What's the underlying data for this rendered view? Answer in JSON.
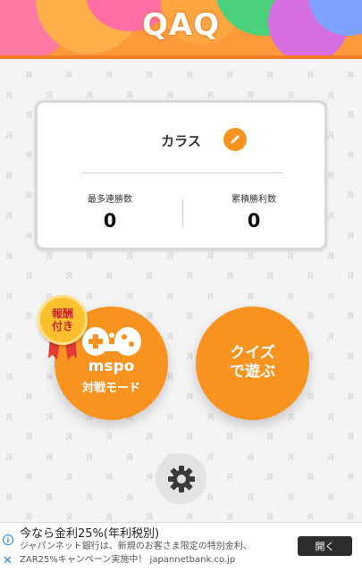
{
  "app": {
    "logo_text": "QAQ"
  },
  "profile": {
    "username": "カラス",
    "edit_icon": "pencil-icon",
    "stats": [
      {
        "label": "最多連勝数",
        "value": "0"
      },
      {
        "label": "累積勝利数",
        "value": "0"
      }
    ]
  },
  "modes": {
    "battle": {
      "badge": [
        "報酬",
        "付き"
      ],
      "logo": "mspo",
      "label": "対戦モード",
      "icon": "gamepad-icon"
    },
    "quiz": {
      "label_line1": "クイズ",
      "label_line2": "で遊ぶ"
    }
  },
  "settings": {
    "icon": "gear-icon"
  },
  "ad": {
    "title": "今なら金利25%(年利税別)",
    "description": "ジャパンネット銀行は、新規のお客さま限定の特別金利、ZAR25%キャンペーン実施中！ japannetbank.co.jp",
    "button": "開く",
    "info_icon": "info-icon",
    "close_icon": "close-icon"
  },
  "colors": {
    "accent": "#f7931e",
    "header": "#ff9a3c",
    "background": "#f4f4f4"
  }
}
